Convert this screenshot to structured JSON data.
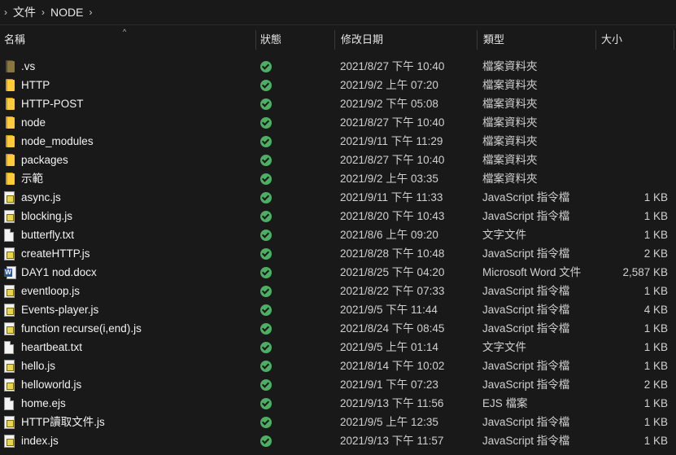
{
  "breadcrumb": {
    "items": [
      "文件",
      "NODE"
    ]
  },
  "columns": {
    "name": "名稱",
    "status": "狀態",
    "date": "修改日期",
    "type": "類型",
    "size": "大小"
  },
  "files": [
    {
      "icon": "folder-dim",
      "name": ".vs",
      "date": "2021/8/27 下午 10:40",
      "type": "檔案資料夾",
      "size": ""
    },
    {
      "icon": "folder",
      "name": "HTTP",
      "date": "2021/9/2 上午 07:20",
      "type": "檔案資料夾",
      "size": ""
    },
    {
      "icon": "folder",
      "name": "HTTP-POST",
      "date": "2021/9/2 下午 05:08",
      "type": "檔案資料夾",
      "size": ""
    },
    {
      "icon": "folder",
      "name": "node",
      "date": "2021/8/27 下午 10:40",
      "type": "檔案資料夾",
      "size": ""
    },
    {
      "icon": "folder",
      "name": "node_modules",
      "date": "2021/9/11 下午 11:29",
      "type": "檔案資料夾",
      "size": ""
    },
    {
      "icon": "folder",
      "name": "packages",
      "date": "2021/8/27 下午 10:40",
      "type": "檔案資料夾",
      "size": ""
    },
    {
      "icon": "folder",
      "name": "示範",
      "date": "2021/9/2 上午 03:35",
      "type": "檔案資料夾",
      "size": ""
    },
    {
      "icon": "js",
      "name": "async.js",
      "date": "2021/9/11 下午 11:33",
      "type": "JavaScript 指令檔",
      "size": "1 KB"
    },
    {
      "icon": "js",
      "name": "blocking.js",
      "date": "2021/8/20 下午 10:43",
      "type": "JavaScript 指令檔",
      "size": "1 KB"
    },
    {
      "icon": "txt",
      "name": "butterfly.txt",
      "date": "2021/8/6 上午 09:20",
      "type": "文字文件",
      "size": "1 KB"
    },
    {
      "icon": "js",
      "name": "createHTTP.js",
      "date": "2021/8/28 下午 10:48",
      "type": "JavaScript 指令檔",
      "size": "2 KB"
    },
    {
      "icon": "word",
      "name": "DAY1 nod.docx",
      "date": "2021/8/25 下午 04:20",
      "type": "Microsoft Word 文件",
      "size": "2,587 KB"
    },
    {
      "icon": "js",
      "name": "eventloop.js",
      "date": "2021/8/22 下午 07:33",
      "type": "JavaScript 指令檔",
      "size": "1 KB"
    },
    {
      "icon": "js",
      "name": "Events-player.js",
      "date": "2021/9/5 下午 11:44",
      "type": "JavaScript 指令檔",
      "size": "4 KB"
    },
    {
      "icon": "js",
      "name": "function recurse(i,end).js",
      "date": "2021/8/24 下午 08:45",
      "type": "JavaScript 指令檔",
      "size": "1 KB"
    },
    {
      "icon": "txt",
      "name": "heartbeat.txt",
      "date": "2021/9/5 上午 01:14",
      "type": "文字文件",
      "size": "1 KB"
    },
    {
      "icon": "js",
      "name": "hello.js",
      "date": "2021/8/14 下午 10:02",
      "type": "JavaScript 指令檔",
      "size": "1 KB"
    },
    {
      "icon": "js",
      "name": "helloworld.js",
      "date": "2021/9/1 下午 07:23",
      "type": "JavaScript 指令檔",
      "size": "2 KB"
    },
    {
      "icon": "txt",
      "name": "home.ejs",
      "date": "2021/9/13 下午 11:56",
      "type": "EJS 檔案",
      "size": "1 KB"
    },
    {
      "icon": "js",
      "name": "HTTP讀取文件.js",
      "date": "2021/9/5 上午 12:35",
      "type": "JavaScript 指令檔",
      "size": "1 KB"
    },
    {
      "icon": "js",
      "name": "index.js",
      "date": "2021/9/13 下午 11:57",
      "type": "JavaScript 指令檔",
      "size": "1 KB"
    }
  ],
  "colors": {
    "background": "#191919",
    "status_ok": "#4caf63",
    "folder": "#ffcb3d"
  }
}
